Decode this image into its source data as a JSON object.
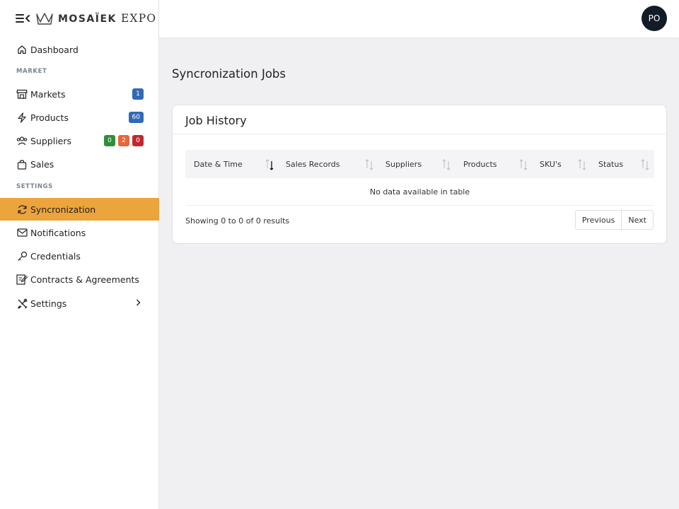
{
  "brand": {
    "name_bold": "MOSAÏEK",
    "name_rest": " EXPO"
  },
  "colors": {
    "active": "#eca43c",
    "badge_blue": "#3269b6",
    "badge_green": "#2f8f3a",
    "badge_orange": "#e8663c",
    "badge_red": "#c1272d",
    "avatar_bg": "#121b26"
  },
  "user": {
    "initials": "PO"
  },
  "sidebar": {
    "dashboard": "Dashboard",
    "section_market": "MARKET",
    "markets": {
      "label": "Markets",
      "badge": "1"
    },
    "products": {
      "label": "Products",
      "badge": "60"
    },
    "suppliers": {
      "label": "Suppliers",
      "badges": [
        "0",
        "2",
        "0"
      ]
    },
    "sales": "Sales",
    "section_settings": "SETTINGS",
    "syncronization": "Syncronization",
    "notifications": "Notifications",
    "credentials": "Credentials",
    "contracts": "Contracts & Agreements",
    "settings": "Settings"
  },
  "page": {
    "title": "Syncronization Jobs"
  },
  "card": {
    "title": "Job History",
    "columns": [
      "Date & Time",
      "Sales Records",
      "Suppliers",
      "Products",
      "SKU's",
      "Status"
    ],
    "empty": "No data available in table",
    "info": "Showing 0 to 0 of 0 results",
    "prev": "Previous",
    "next": "Next"
  }
}
